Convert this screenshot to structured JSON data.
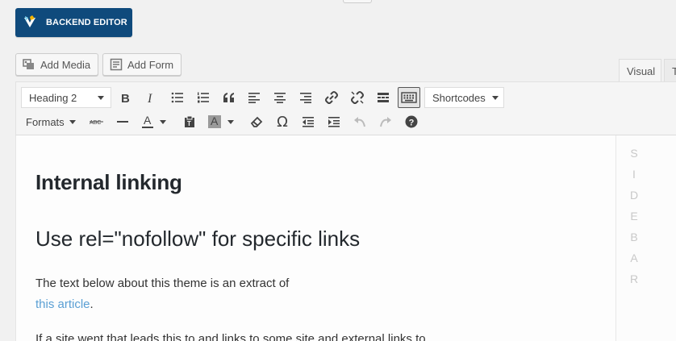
{
  "backend_editor": {
    "label": "BACKEND EDITOR"
  },
  "media_buttons": {
    "add_media": "Add Media",
    "add_form": "Add Form"
  },
  "tabs": {
    "visual": "Visual",
    "text": "T"
  },
  "toolbar": {
    "heading_select": "Heading 2",
    "shortcodes_select": "Shortcodes",
    "formats": "Formats",
    "strike_label": "ABC",
    "text_color_letter": "A",
    "bg_color_letter": "A",
    "omega": "Ω",
    "help": "?",
    "icons": [
      "bold-icon",
      "italic-icon",
      "bullet-list-icon",
      "numbered-list-icon",
      "blockquote-icon",
      "align-left-icon",
      "align-center-icon",
      "align-right-icon",
      "link-icon",
      "unlink-icon",
      "read-more-icon",
      "toolbar-toggle-icon",
      "strikethrough-icon",
      "horizontal-line-icon",
      "text-color-icon",
      "paste-text-icon",
      "background-color-icon",
      "clear-formatting-icon",
      "special-character-icon",
      "outdent-icon",
      "indent-icon",
      "undo-icon",
      "redo-icon",
      "help-icon"
    ]
  },
  "content": {
    "heading": "Internal linking",
    "subheading": "Use rel=\"nofollow\" for specific links",
    "paragraph_text": "The text below about this theme is an extract of",
    "paragraph_link": "this article",
    "paragraph_end": ".",
    "cut_line": "If a site went that leads this to and links to some site and external links to"
  },
  "sidebar": {
    "letters": [
      "S",
      "I",
      "D",
      "E",
      "B",
      "A",
      "R"
    ]
  },
  "colors": {
    "brand": "#0f4a7c",
    "link": "#5a9fd4"
  }
}
